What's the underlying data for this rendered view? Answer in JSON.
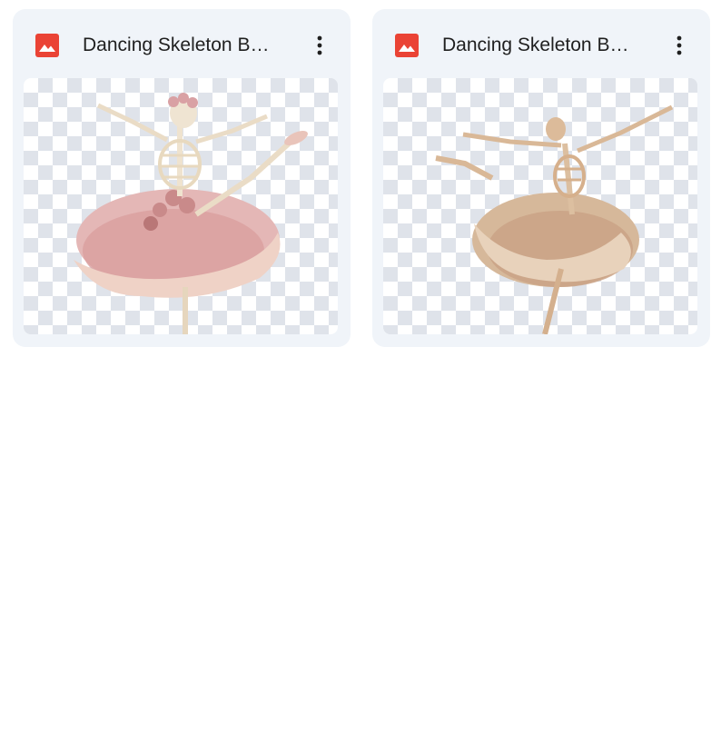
{
  "files": [
    {
      "name": "Dancing Skeleton Ballerina.png",
      "type_icon": "image-file-icon",
      "menu_icon": "more-vert-icon",
      "thumbnail": "pink-tutu-skeleton-ballerina"
    },
    {
      "name": "Dancing Skeleton Ballerina.png",
      "type_icon": "image-file-icon",
      "menu_icon": "more-vert-icon",
      "thumbnail": "beige-tutu-skeleton-ballerina"
    }
  ],
  "colors": {
    "card_background": "#f0f4f9",
    "image_icon_red": "#ea4335",
    "text": "#1f1f1f",
    "checker": "#dfe3ea"
  }
}
